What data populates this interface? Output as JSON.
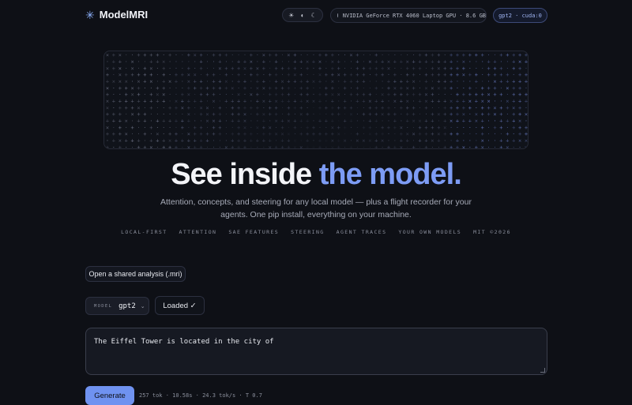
{
  "header": {
    "brand": "ModelMRI",
    "brand_icon": "asterisk-icon",
    "theme_icons": [
      "sun-icon",
      "half-moon-icon",
      "moon-icon"
    ],
    "theme_glyphs": [
      "☀",
      "◐",
      "☾"
    ],
    "gpu_label": "NVIDIA GeForce RTX 4060 Laptop GPU · 8.6 GB",
    "model_device": "gpt2 · cuda:0"
  },
  "hero": {
    "headline_main": "See inside",
    "headline_accent": "the model.",
    "subtitle": "Attention, concepts, and steering for any local model — plus a flight recorder for your agents. One pip install, everything on your machine.",
    "tags": [
      "LOCAL-FIRST",
      "ATTENTION",
      "SAE FEATURES",
      "STEERING",
      "AGENT TRACES",
      "YOUR OWN MODELS",
      "MIT ©2026"
    ]
  },
  "controls": {
    "shared_analysis_label": "Open a shared analysis (.mri)",
    "model_label": "MODEL",
    "model_value": "gpt2",
    "loaded_label": "Loaded ✓",
    "prompt_text": "The Eiffel Tower is located in the city of",
    "generate_label": "Generate",
    "stats": "257 tok · 10.58s · 24.3 tok/s · T 0.7"
  },
  "colors": {
    "background": "#0e1016",
    "accent": "#7d9cf5",
    "button": "#6f92f0"
  }
}
